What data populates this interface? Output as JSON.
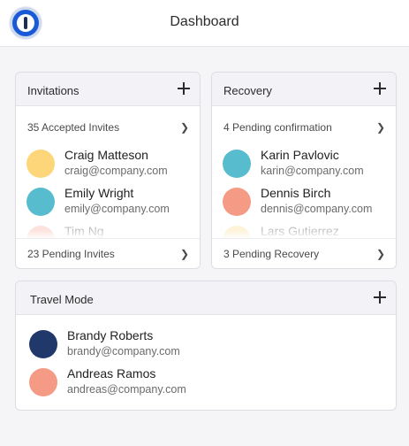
{
  "header": {
    "title": "Dashboard",
    "logo_icon": "1password-logo-icon"
  },
  "colors": {
    "accent": "#1a5ad7",
    "avatar_yellow": "#fdd67a",
    "avatar_teal": "#58bccf",
    "avatar_salmon": "#f59a84",
    "avatar_navy": "#20386a"
  },
  "invitations": {
    "title": "Invitations",
    "summary": "35 Accepted Invites",
    "people": [
      {
        "name": "Craig Matteson",
        "email": "craig@company.com"
      },
      {
        "name": "Emily Wright",
        "email": "emily@company.com"
      },
      {
        "name": "Tim Ng"
      }
    ],
    "footer": "23 Pending Invites"
  },
  "recovery": {
    "title": "Recovery",
    "summary": "4 Pending confirmation",
    "people": [
      {
        "name": "Karin Pavlovic",
        "email": "karin@company.com"
      },
      {
        "name": "Dennis Birch",
        "email": "dennis@company.com"
      },
      {
        "name": "Lars Gutierrez"
      }
    ],
    "footer": "3 Pending Recovery"
  },
  "travel": {
    "title": "Travel Mode",
    "people": [
      {
        "name": "Brandy Roberts",
        "email": "brandy@company.com"
      },
      {
        "name": "Andreas Ramos",
        "email": "andreas@company.com"
      }
    ]
  },
  "chevron": "❯"
}
